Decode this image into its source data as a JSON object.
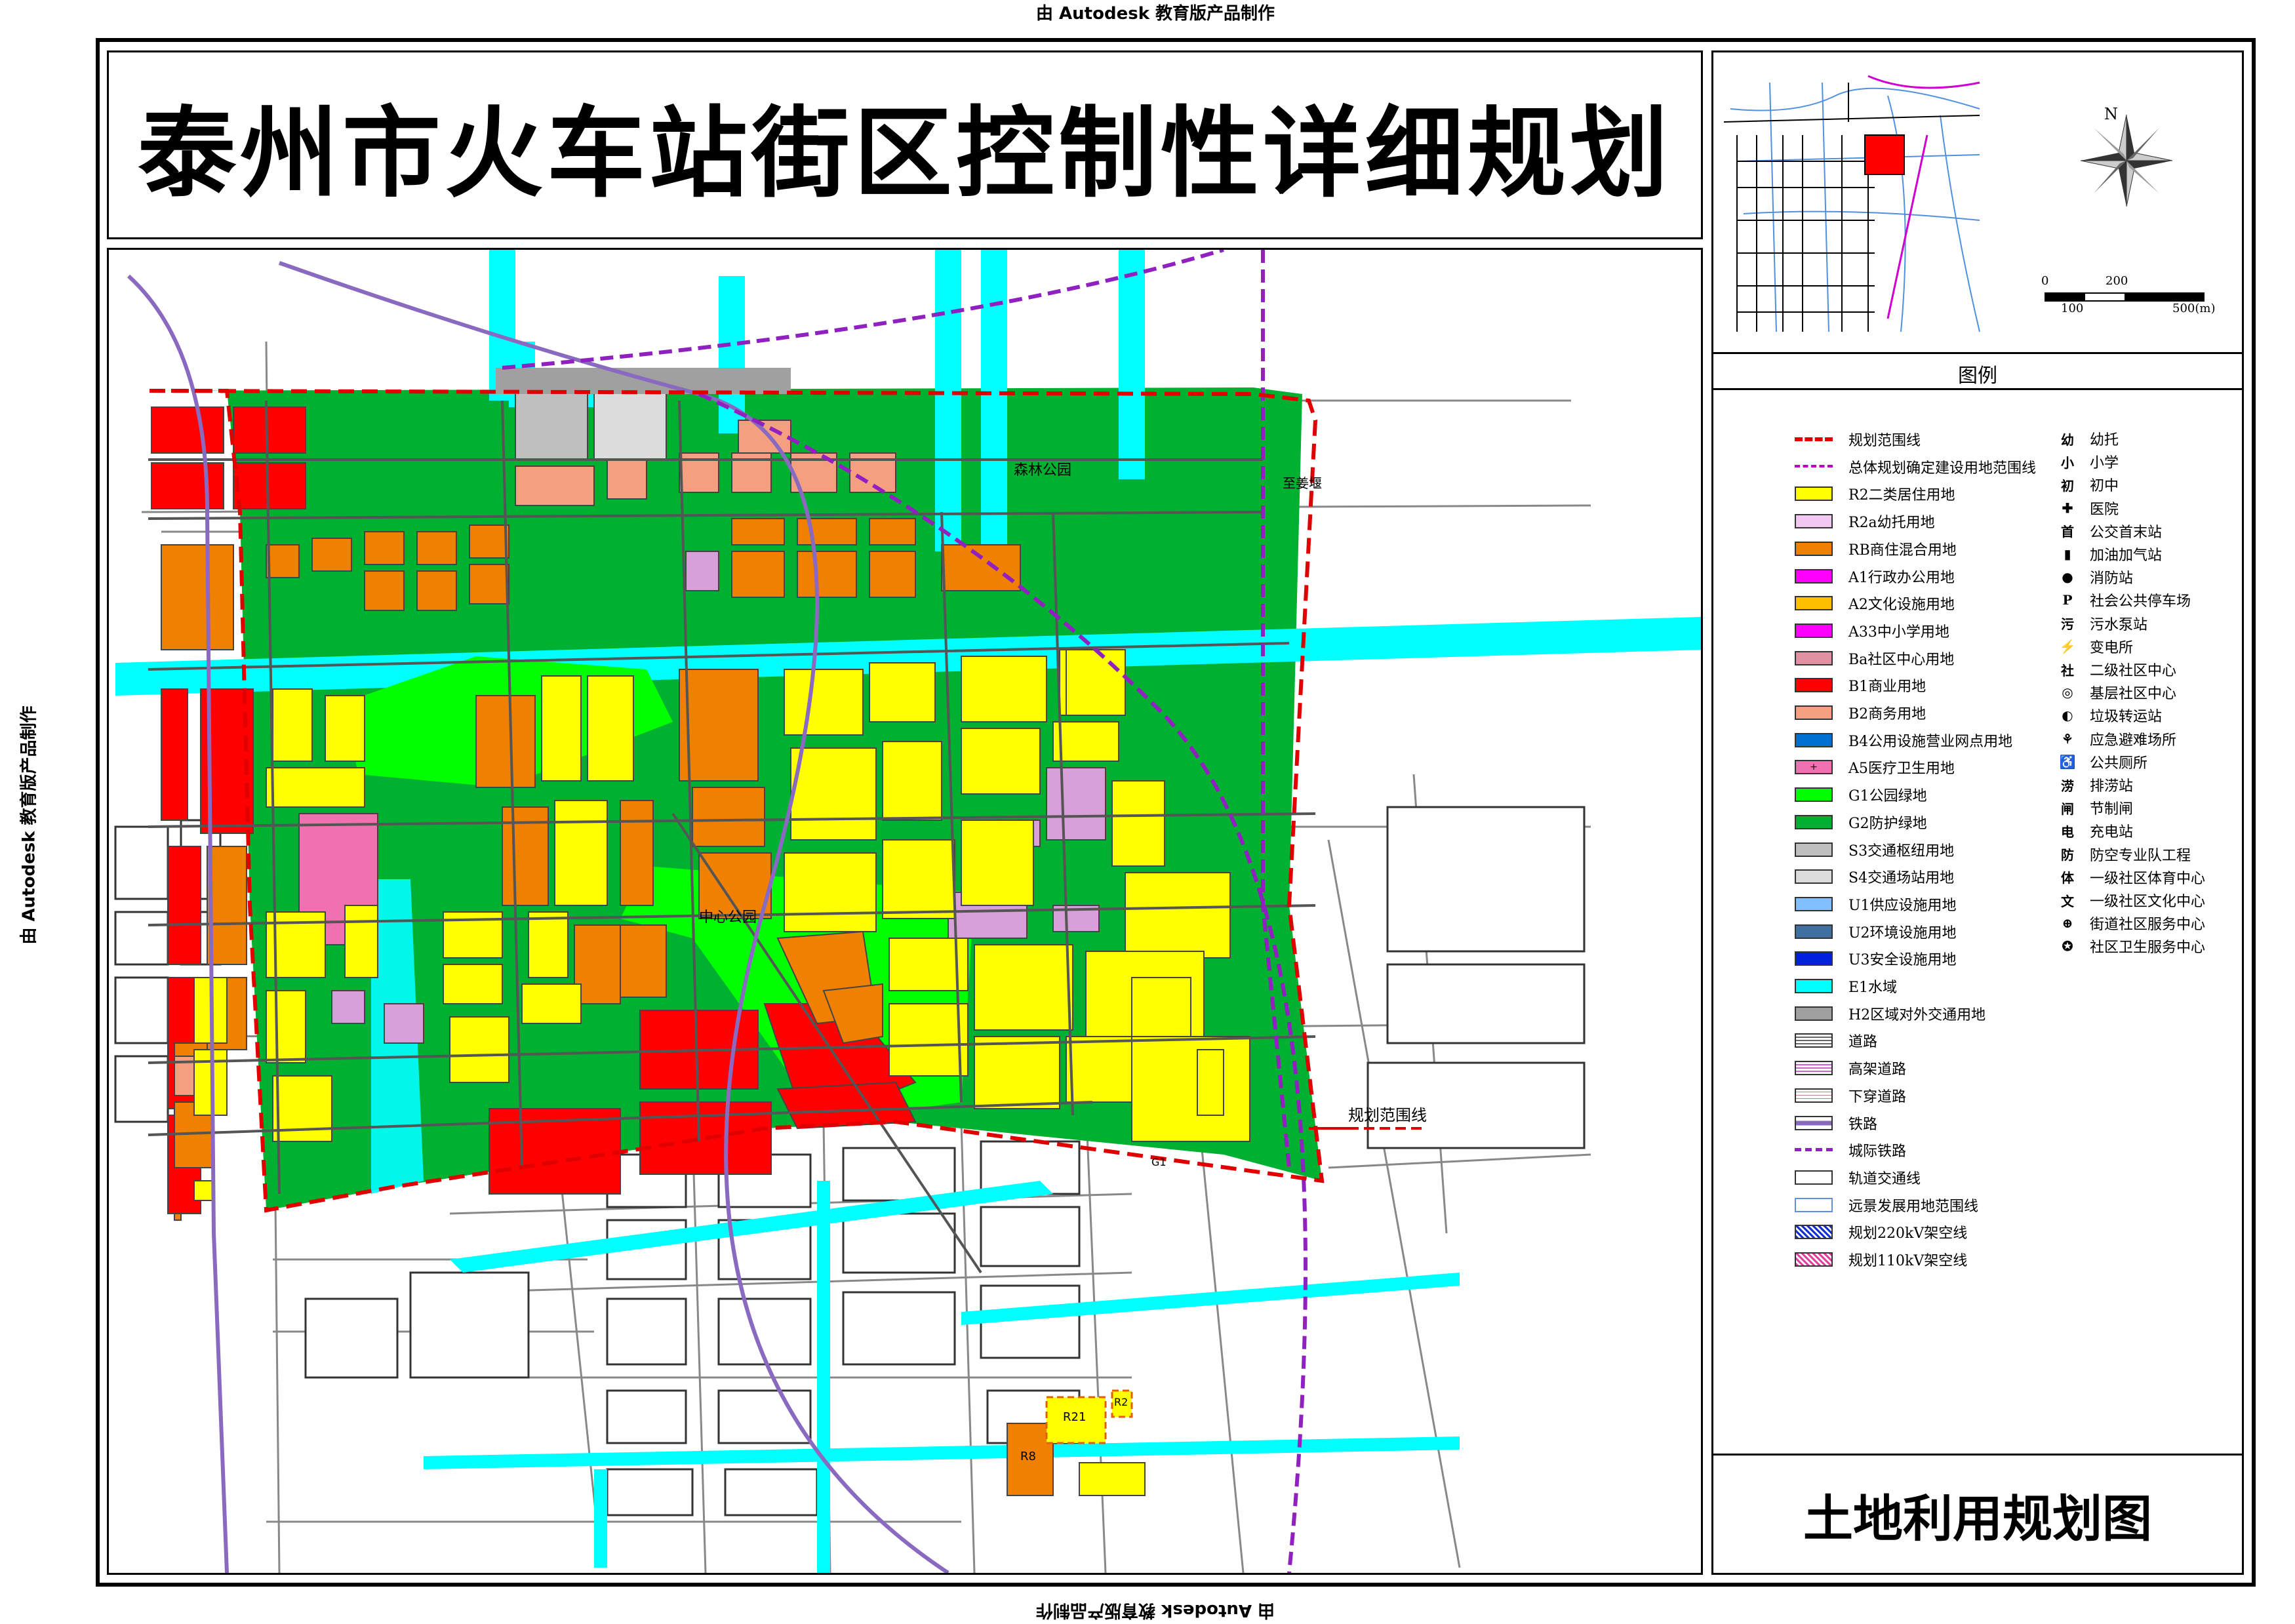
{
  "watermark": "由 Autodesk 教育版产品制作",
  "title": "泰州市火车站街区控制性详细规划",
  "map_title": "土地利用规划图",
  "legend_title": "图例",
  "north_label": "N",
  "scale_labels": [
    "0",
    "200",
    "100",
    "500(m)"
  ],
  "annotations": {
    "boundary_label": "规划范围线",
    "forest_park": "森林公园",
    "central_park": "中心公园",
    "road_zhijianghe": "至姜堰",
    "r8": "R8",
    "r21": "R21",
    "r2": "R2",
    "g1": "G1"
  },
  "legend_colors": {
    "r2": "#ffff00",
    "r2a": "#f0c8f0",
    "rb": "#f08000",
    "a1": "#ff00ff",
    "a2": "#ffbf00",
    "a33": "#ff00ff",
    "ba": "#e090a0",
    "b1": "#ff0000",
    "b2": "#f4a080",
    "b4": "#0070d0",
    "a5": "#f070b0",
    "g1": "#00ff00",
    "g2": "#00b030",
    "s3": "#bfbfbf",
    "s4": "#dcdcdc",
    "u1": "#80c0ff",
    "u2": "#4070a0",
    "u3": "#0020e0",
    "e1": "#00ffff",
    "h2": "#a0a0a0"
  },
  "legend": [
    {
      "label": "规划范围线",
      "key": "boundary"
    },
    {
      "label": "总体规划确定建设用地范围线",
      "key": "gp-boundary"
    },
    {
      "label": "R2二类居住用地",
      "key": "r2"
    },
    {
      "label": "R2a幼托用地",
      "key": "r2a"
    },
    {
      "label": "RB商住混合用地",
      "key": "rb"
    },
    {
      "label": "A1行政办公用地",
      "key": "a1"
    },
    {
      "label": "A2文化设施用地",
      "key": "a2"
    },
    {
      "label": "A33中小学用地",
      "key": "a33"
    },
    {
      "label": "Ba社区中心用地",
      "key": "ba"
    },
    {
      "label": "B1商业用地",
      "key": "b1"
    },
    {
      "label": "B2商务用地",
      "key": "b2"
    },
    {
      "label": "B4公用设施营业网点用地",
      "key": "b4"
    },
    {
      "label": "A5医疗卫生用地",
      "key": "a5"
    },
    {
      "label": "G1公园绿地",
      "key": "g1"
    },
    {
      "label": "G2防护绿地",
      "key": "g2"
    },
    {
      "label": "S3交通枢纽用地",
      "key": "s3"
    },
    {
      "label": "S4交通场站用地",
      "key": "s4"
    },
    {
      "label": "U1供应设施用地",
      "key": "u1"
    },
    {
      "label": "U2环境设施用地",
      "key": "u2"
    },
    {
      "label": "U3安全设施用地",
      "key": "u3"
    },
    {
      "label": "E1水域",
      "key": "e1"
    },
    {
      "label": "H2区域对外交通用地",
      "key": "h2"
    },
    {
      "label": "道路",
      "key": "road"
    },
    {
      "label": "高架道路",
      "key": "elevated"
    },
    {
      "label": "下穿道路",
      "key": "underpass"
    },
    {
      "label": "铁路",
      "key": "railway"
    },
    {
      "label": "城际铁路",
      "key": "intercity"
    },
    {
      "label": "轨道交通线",
      "key": "metro"
    },
    {
      "label": "远景发展用地范围线",
      "key": "future"
    },
    {
      "label": "规划220kV架空线",
      "key": "kv220"
    },
    {
      "label": "规划110kV架空线",
      "key": "kv110"
    }
  ],
  "symbols": [
    {
      "sym": "幼",
      "label": "幼托"
    },
    {
      "sym": "小",
      "label": "小学"
    },
    {
      "sym": "初",
      "label": "初中"
    },
    {
      "sym": "✚",
      "label": "医院"
    },
    {
      "sym": "首",
      "label": "公交首末站"
    },
    {
      "sym": "▮",
      "label": "加油加气站"
    },
    {
      "sym": "●",
      "label": "消防站"
    },
    {
      "sym": "P",
      "label": "社会公共停车场"
    },
    {
      "sym": "污",
      "label": "污水泵站"
    },
    {
      "sym": "⚡",
      "label": "变电所"
    },
    {
      "sym": "社",
      "label": "二级社区中心"
    },
    {
      "sym": "◎",
      "label": "基层社区中心"
    },
    {
      "sym": "◐",
      "label": "垃圾转运站"
    },
    {
      "sym": "⚘",
      "label": "应急避难场所"
    },
    {
      "sym": "♿",
      "label": "公共厕所"
    },
    {
      "sym": "涝",
      "label": "排涝站"
    },
    {
      "sym": "闸",
      "label": "节制闸"
    },
    {
      "sym": "电",
      "label": "充电站"
    },
    {
      "sym": "防",
      "label": "防空专业队工程"
    },
    {
      "sym": "体",
      "label": "一级社区体育中心"
    },
    {
      "sym": "文",
      "label": "一级社区文化中心"
    },
    {
      "sym": "⊕",
      "label": "街道社区服务中心"
    },
    {
      "sym": "✪",
      "label": "社区卫生服务中心"
    }
  ]
}
